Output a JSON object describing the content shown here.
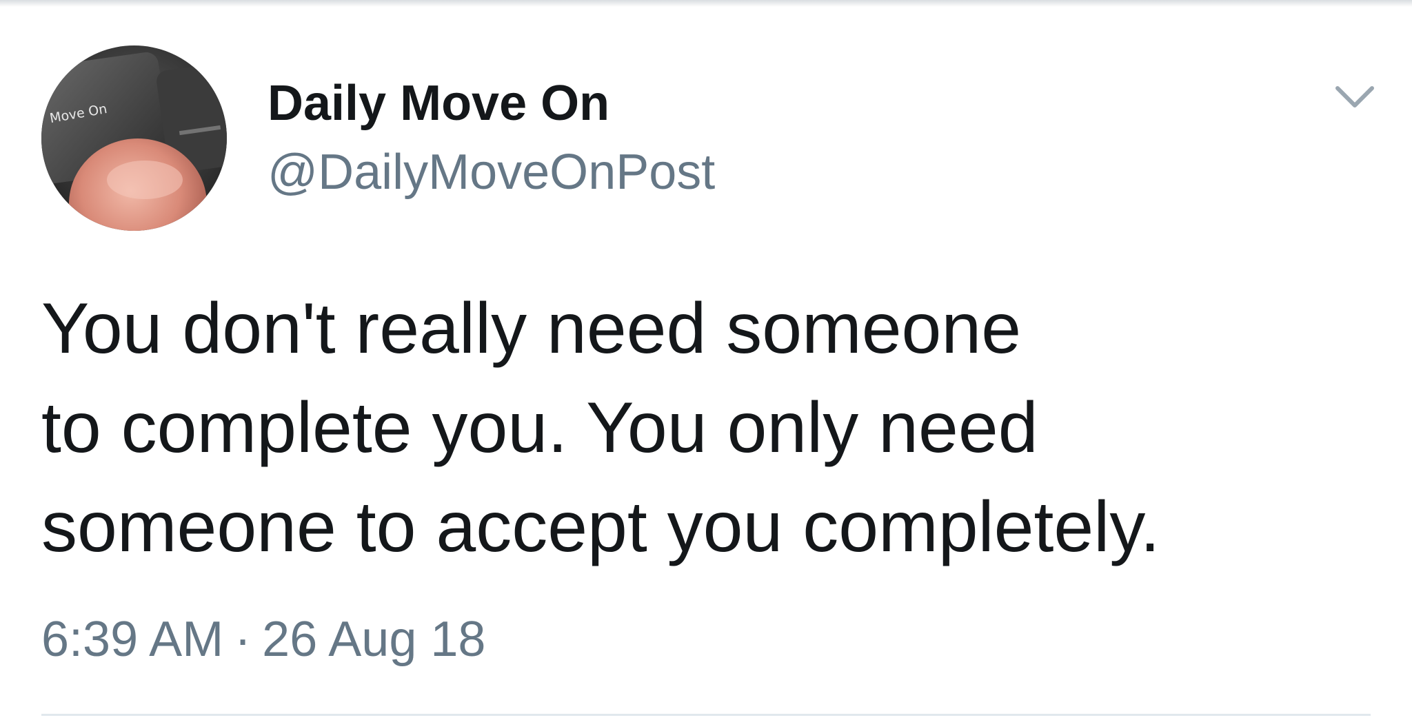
{
  "tweet": {
    "author": {
      "display_name": "Daily Move On",
      "handle": "@DailyMoveOnPost",
      "avatar_key_label": "Move On"
    },
    "text_lines": [
      "You don't really need someone",
      "to complete you. You only need",
      "someone to accept you completely."
    ],
    "time": "6:39 AM",
    "separator": "·",
    "date": "26 Aug 18"
  },
  "icons": {
    "menu": "chevron-down-icon"
  },
  "colors": {
    "text_primary": "#14171a",
    "text_secondary": "#657786",
    "divider": "#e1e8ed"
  }
}
